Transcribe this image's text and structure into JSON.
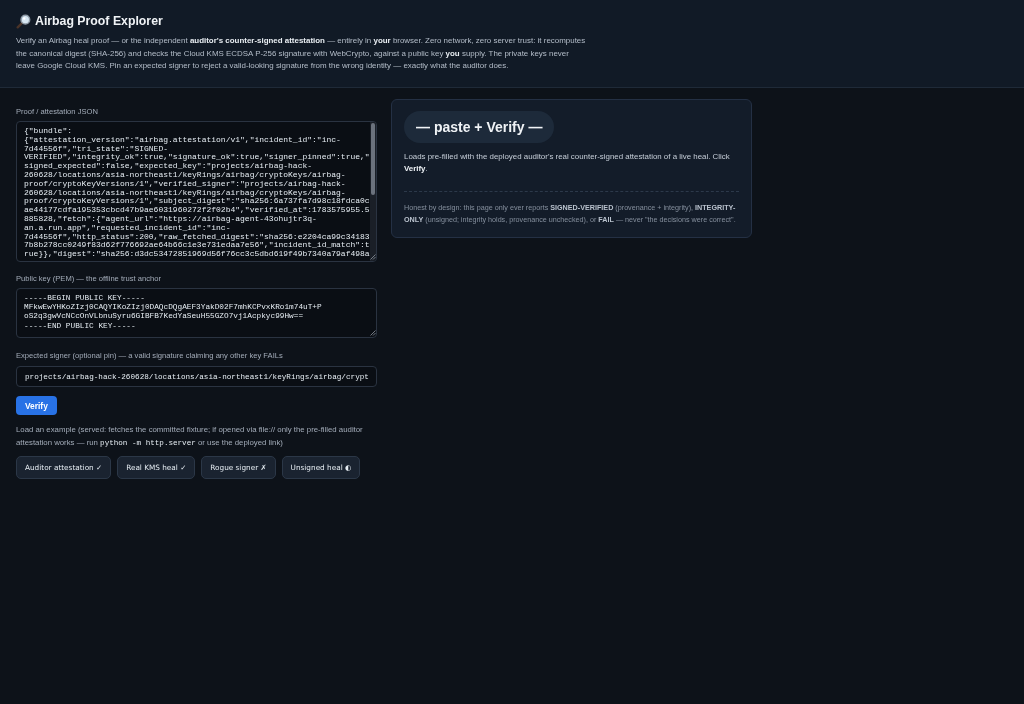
{
  "header": {
    "title": "Airbag Proof Explorer",
    "description": "Verify an Airbag heal proof — or the independent **auditor's counter-signed attestation** — entirely in **your** browser. Zero network, zero server trust: it recomputes the canonical digest (SHA-256) and checks the Cloud KMS ECDSA P-256 signature with WebCrypto, against a public key **you** supply. The private keys never leave Google Cloud KMS. Pin an expected signer to reject a valid-looking signature from the wrong identity — exactly what the auditor does."
  },
  "form": {
    "proof_field": {
      "label": "Proof / attestation JSON",
      "value": "{\"bundle\":{\"attestation_version\":\"airbag.attestation/v1\",\"incident_id\":\"inc-7d44556f\",\"tri_state\":\"SIGNED-VERIFIED\",\"integrity_ok\":true,\"signature_ok\":true,\"signer_pinned\":true,\"signed_expected\":false,\"expected_key\":\"projects/airbag-hack-260628/locations/asia-northeast1/keyRings/airbag/cryptoKeys/airbag-proof/cryptoKeyVersions/1\",\"verified_signer\":\"projects/airbag-hack-260628/locations/asia-northeast1/keyRings/airbag/cryptoKeys/airbag-proof/cryptoKeyVersions/1\",\"subject_digest\":\"sha256:6a737fa7d98c18fdca0cae44177cdfa195353cbcd47b9ae6031960272f2f02b4\",\"verified_at\":1783575955.5885828,\"fetch\":{\"agent_url\":\"https://airbag-agent-43ohujtr3q-an.a.run.app\",\"requested_incident_id\":\"inc-7d44556f\",\"http_status\":200,\"raw_fetched_digest\":\"sha256:e2204ca99c341837b8b278cc0249f83d62f776692ae64b66c1e3e731edaa7e56\",\"incident_id_match\":true}},\"digest\":\"sha256:d3dc53472851969d56f76cc3c5dbd619f49b7340a79af498a"
    },
    "public_key_field": {
      "label": "Public key (PEM) — the offline trust anchor",
      "value": "-----BEGIN PUBLIC KEY-----\nMFkwEwYHKoZIzj0CAQYIKoZIzj0DAQcDQgAEF3YakD02F7mhKCPvxKRo1m74uT+P\noS2q3gwVcNCcOnVLbnuSyru6GIBFB7KedYaSeuH55GZO7vj1Acpkyc99Hw==\n-----END PUBLIC KEY-----"
    },
    "signer_field": {
      "label": "Expected signer (optional pin) — a valid signature claiming any other key FAILs",
      "value": "projects/airbag-hack-260628/locations/asia-northeast1/keyRings/airbag/crypt"
    },
    "verify_button": "Verify",
    "examples_hint": {
      "text_before": "Load an example (served: fetches the committed fixture; if opened via file:// only the pre-filled auditor attestation works — run ",
      "code": "python -m http.server",
      "text_after": " or use the deployed link)"
    },
    "examples": [
      "Auditor attestation ✓",
      "Real KMS heal ✓",
      "Rogue signer ✗",
      "Unsigned heal ◐"
    ]
  },
  "result_panel": {
    "status": "— paste + Verify —",
    "message": "Loads pre-filled with the deployed auditor's real counter-signed attestation of a live heal. Click **Verify**.",
    "note": "Honest by design: this page only ever reports **SIGNED-VERIFIED** (provenance + integrity), **INTEGRITY-ONLY** (unsigned; integrity holds, provenance unchecked), or **FAIL** — never \"the decisions were correct\"."
  }
}
